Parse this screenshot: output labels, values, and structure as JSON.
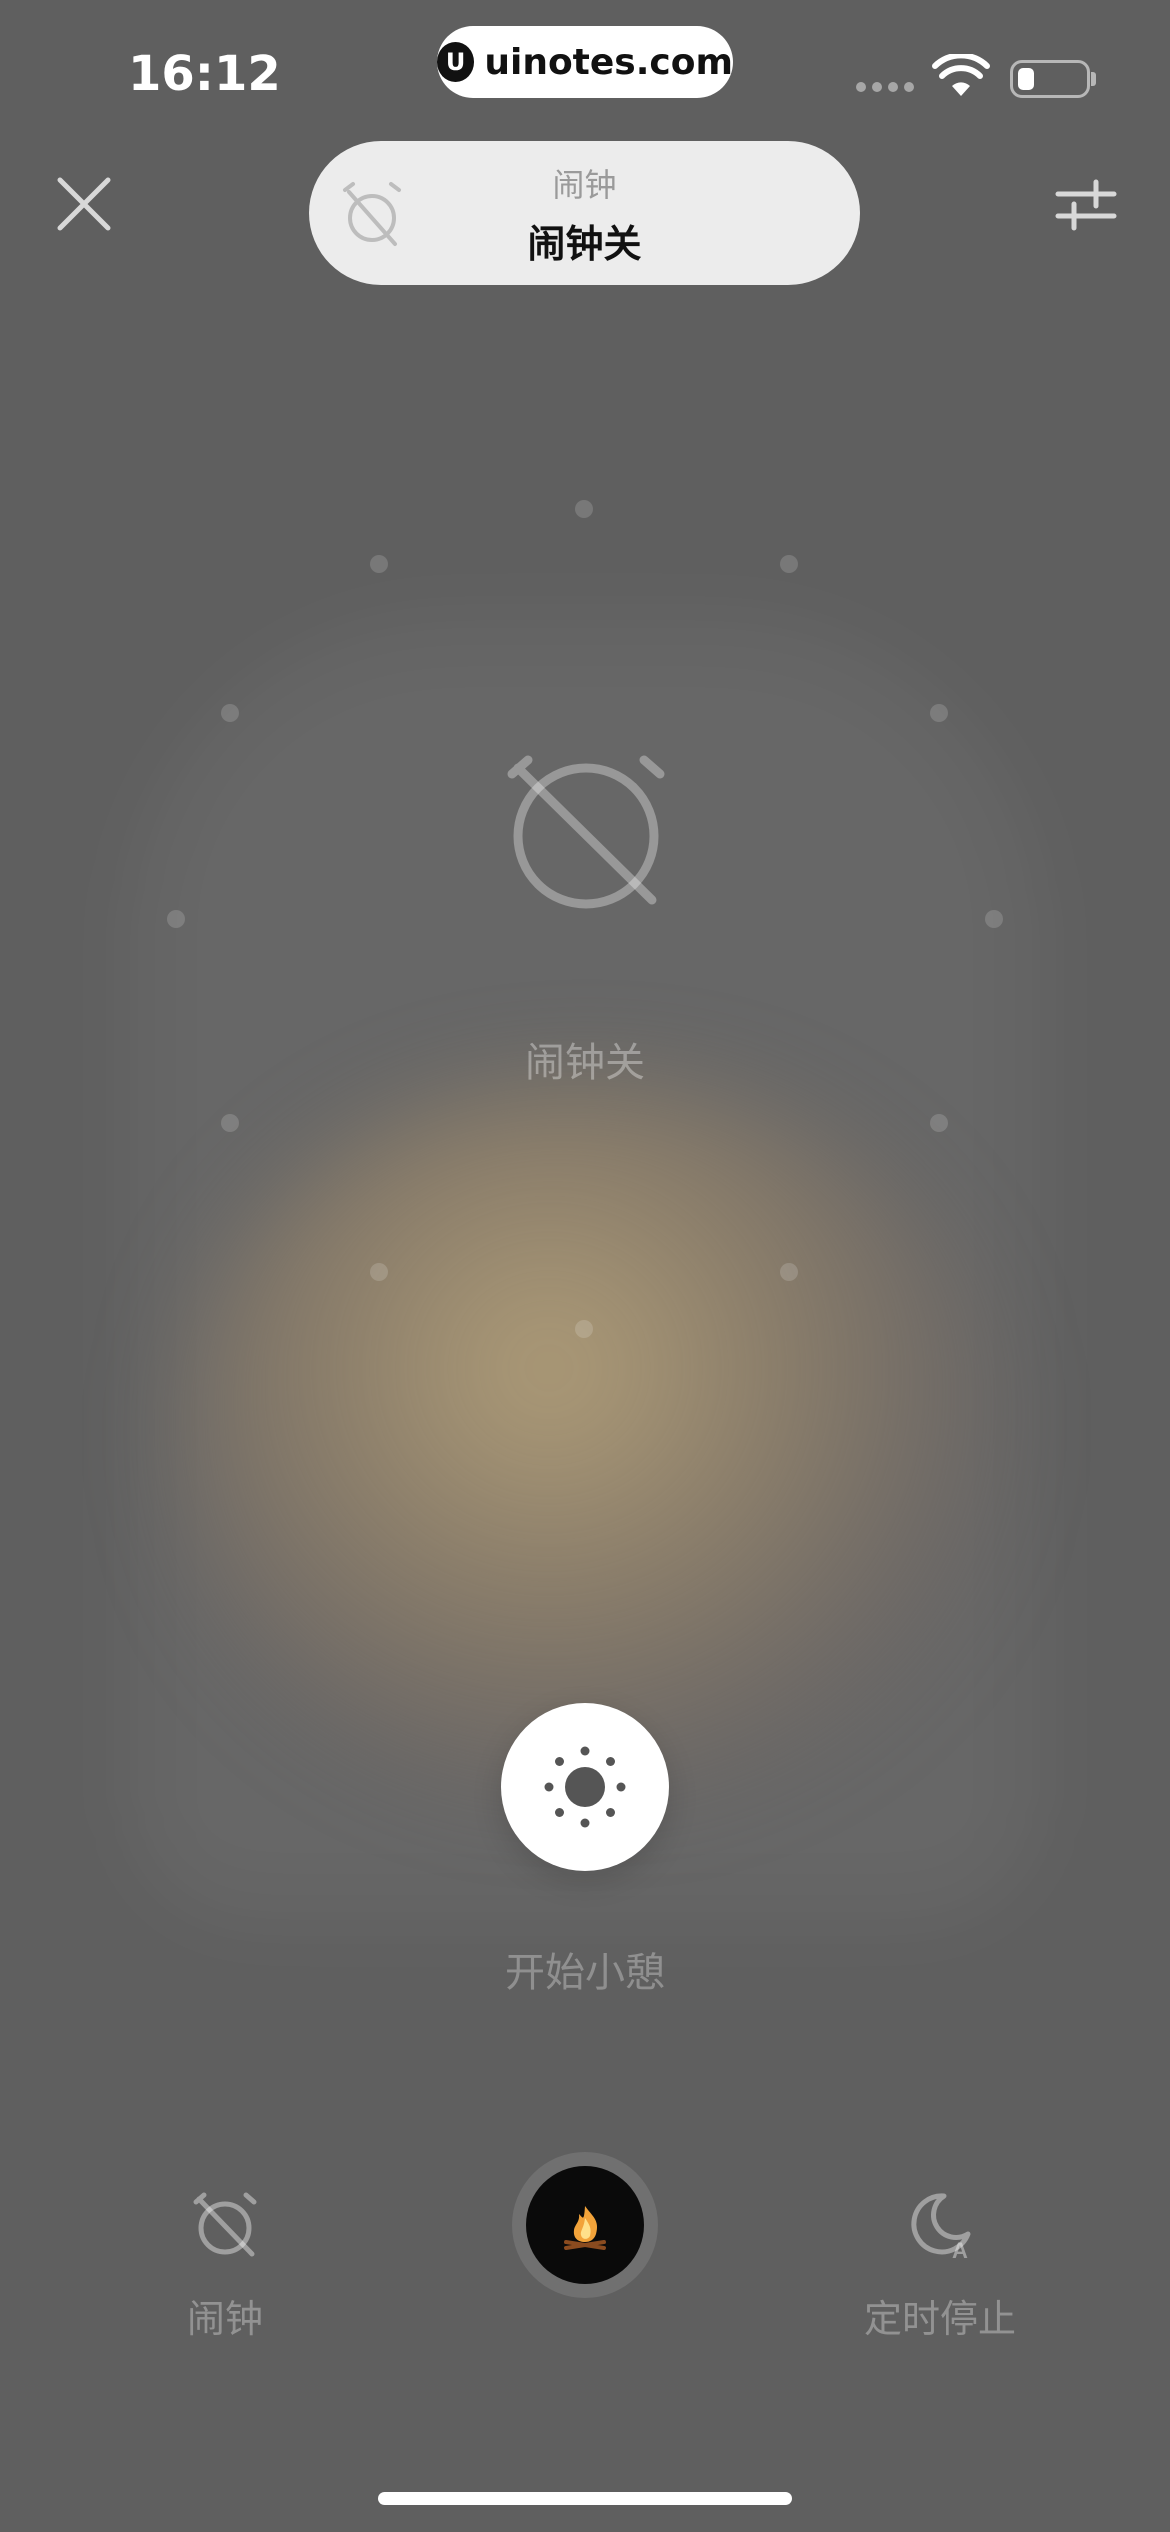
{
  "status_bar": {
    "time": "16:12",
    "watermark": "uinotes.com",
    "watermark_logo": "U",
    "battery_level": 0.25
  },
  "top": {
    "close_icon": "close-icon",
    "settings_icon": "sliders-icon",
    "pill": {
      "icon": "alarm-off-icon",
      "subtitle": "闹钟",
      "title": "闹钟关"
    }
  },
  "center": {
    "icon": "alarm-off-icon",
    "label": "闹钟关"
  },
  "break_button": {
    "icon": "sun-icon",
    "label": "开始小憩"
  },
  "bottom_bar": {
    "alarm": {
      "icon": "alarm-off-icon",
      "label": "闹钟"
    },
    "sound": {
      "icon": "campfire-icon"
    },
    "timer": {
      "icon": "moon-auto-icon",
      "label": "定时停止"
    }
  },
  "colors": {
    "background": "#5f5f5f",
    "glow": "#c4ac7d",
    "pill": "#ececec"
  }
}
